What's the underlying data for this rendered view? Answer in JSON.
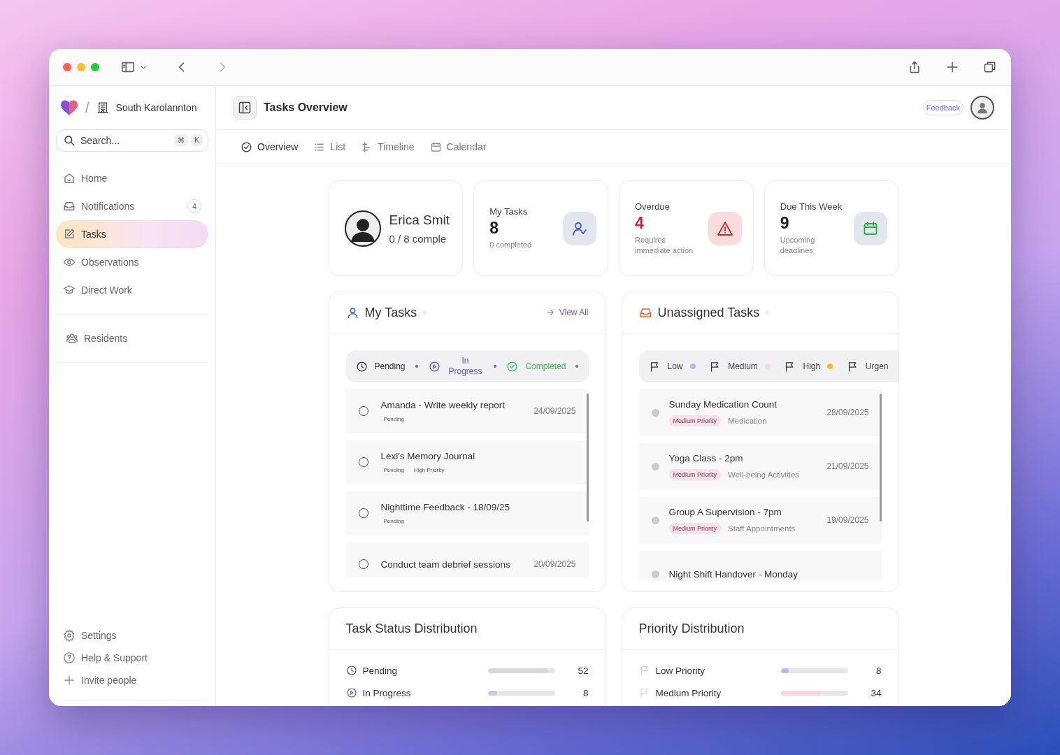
{
  "breadcrumb": {
    "separator": "/",
    "organization": "South Karolannton"
  },
  "search": {
    "placeholder": "Search...",
    "shortcut_keys": [
      "⌘",
      "K"
    ]
  },
  "sidebar": {
    "items": [
      {
        "label": "Home",
        "selected": false
      },
      {
        "label": "Notifications",
        "badge": "4",
        "selected": false
      },
      {
        "label": "Tasks",
        "selected": true
      },
      {
        "label": "Observations",
        "selected": false
      },
      {
        "label": "Direct Work",
        "selected": false
      }
    ],
    "secondary_items": [
      {
        "label": "Residents",
        "selected": false
      }
    ],
    "footer_items": [
      {
        "label": "Settings"
      },
      {
        "label": "Help & Support"
      },
      {
        "label": "Invite people"
      }
    ]
  },
  "header": {
    "title": "Tasks Overview",
    "feedback_button": "Feedback"
  },
  "tabs": [
    {
      "label": "Overview",
      "selected": true
    },
    {
      "label": "List",
      "selected": false
    },
    {
      "label": "Timeline",
      "selected": false
    },
    {
      "label": "Calendar",
      "selected": false
    }
  ],
  "stats": [
    {
      "kind": "profile",
      "name": "Erica Smit",
      "note": "0 / 8 comple"
    },
    {
      "kind": "stat",
      "label": "My Tasks",
      "value": "8",
      "note": "0 completed",
      "color": "#3b5bdb"
    },
    {
      "kind": "alert",
      "label": "Overdue",
      "value": "4",
      "note": "Requires immediate action",
      "color": "#c92a3a"
    },
    {
      "kind": "stat",
      "label": "Due This Week",
      "value": "9",
      "note": "Upcoming deadlines",
      "color": "#2fa84f"
    }
  ],
  "my_tasks": {
    "title": "My Tasks",
    "view_all": "View All",
    "filters": [
      {
        "kind": "pending",
        "label": "Pending"
      },
      {
        "kind": "in_progress",
        "label": "In Progress"
      },
      {
        "kind": "completed",
        "label": "Completed"
      }
    ],
    "tasks": [
      {
        "title": "Amanda - Write weekly report",
        "tags": [
          "Pending"
        ],
        "date": "24/09/2025",
        "checked": false
      },
      {
        "title": "Lexi's Memory Journal",
        "tags": [
          "Pending",
          "High Priority"
        ],
        "checked": false
      },
      {
        "title": "Nighttime Feedback - 18/09/25",
        "tags": [
          "Pending"
        ],
        "checked": false
      },
      {
        "title": "Conduct team debrief sessions",
        "date": "20/09/2025",
        "checked": false
      }
    ]
  },
  "unassigned_tasks": {
    "title": "Unassigned Tasks",
    "filters": [
      {
        "label": "Low",
        "color": "#b9b6ee"
      },
      {
        "label": "Medium",
        "color": "#f7dbe7"
      },
      {
        "label": "High",
        "color": "#f5b731"
      },
      {
        "label": "Urgen"
      }
    ],
    "tasks": [
      {
        "title": "Sunday Medication Count",
        "priority": "Medium Priority",
        "category": "Medication",
        "date": "28/09/2025"
      },
      {
        "title": "Yoga Class - 2pm",
        "priority": "Medium Priority",
        "category": "Well-being Activities",
        "date": "21/09/2025"
      },
      {
        "title": "Group A Supervision - 7pm",
        "priority": "Medium Priority",
        "category": "Staff Appointments",
        "date": "19/09/2025"
      },
      {
        "title": "Night Shift Handover - Monday"
      }
    ]
  },
  "status_distribution": {
    "title": "Task Status Distribution",
    "rows": [
      {
        "kind": "pending",
        "label": "Pending",
        "level": 0.9,
        "count": "52"
      },
      {
        "kind": "in_progress",
        "label": "In Progress",
        "level": 0.14,
        "count": "8"
      }
    ]
  },
  "priority_distribution": {
    "title": "Priority Distribution",
    "rows": [
      {
        "kind": "low",
        "label": "Low Priority",
        "level": 0.12,
        "count": "8"
      },
      {
        "kind": "medium",
        "label": "Medium Priority",
        "level": 0.6,
        "count": "34"
      }
    ]
  }
}
